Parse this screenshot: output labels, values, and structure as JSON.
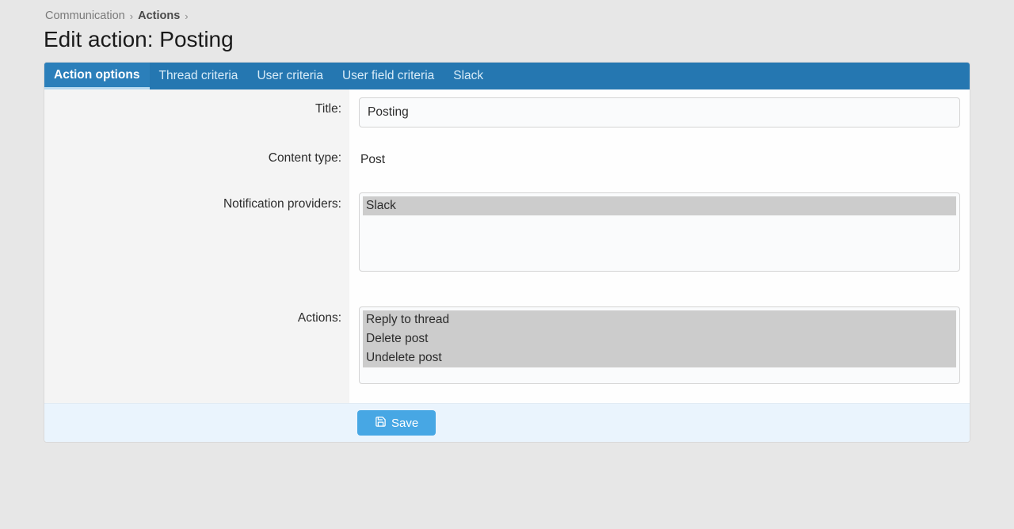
{
  "breadcrumb": {
    "items": [
      {
        "label": "Communication",
        "current": false
      },
      {
        "label": "Actions",
        "current": true
      }
    ]
  },
  "page_title": "Edit action: Posting",
  "tabs": [
    {
      "label": "Action options",
      "active": true
    },
    {
      "label": "Thread criteria",
      "active": false
    },
    {
      "label": "User criteria",
      "active": false
    },
    {
      "label": "User field criteria",
      "active": false
    },
    {
      "label": "Slack",
      "active": false
    }
  ],
  "form": {
    "title_label": "Title:",
    "title_value": "Posting",
    "content_type_label": "Content type:",
    "content_type_value": "Post",
    "providers_label": "Notification providers:",
    "providers_options": [
      {
        "label": "Slack",
        "selected": true
      }
    ],
    "actions_label": "Actions:",
    "actions_options": [
      {
        "label": "Reply to thread",
        "selected": true
      },
      {
        "label": "Delete post",
        "selected": true
      },
      {
        "label": "Undelete post",
        "selected": true
      }
    ]
  },
  "footer": {
    "save_label": "Save"
  }
}
